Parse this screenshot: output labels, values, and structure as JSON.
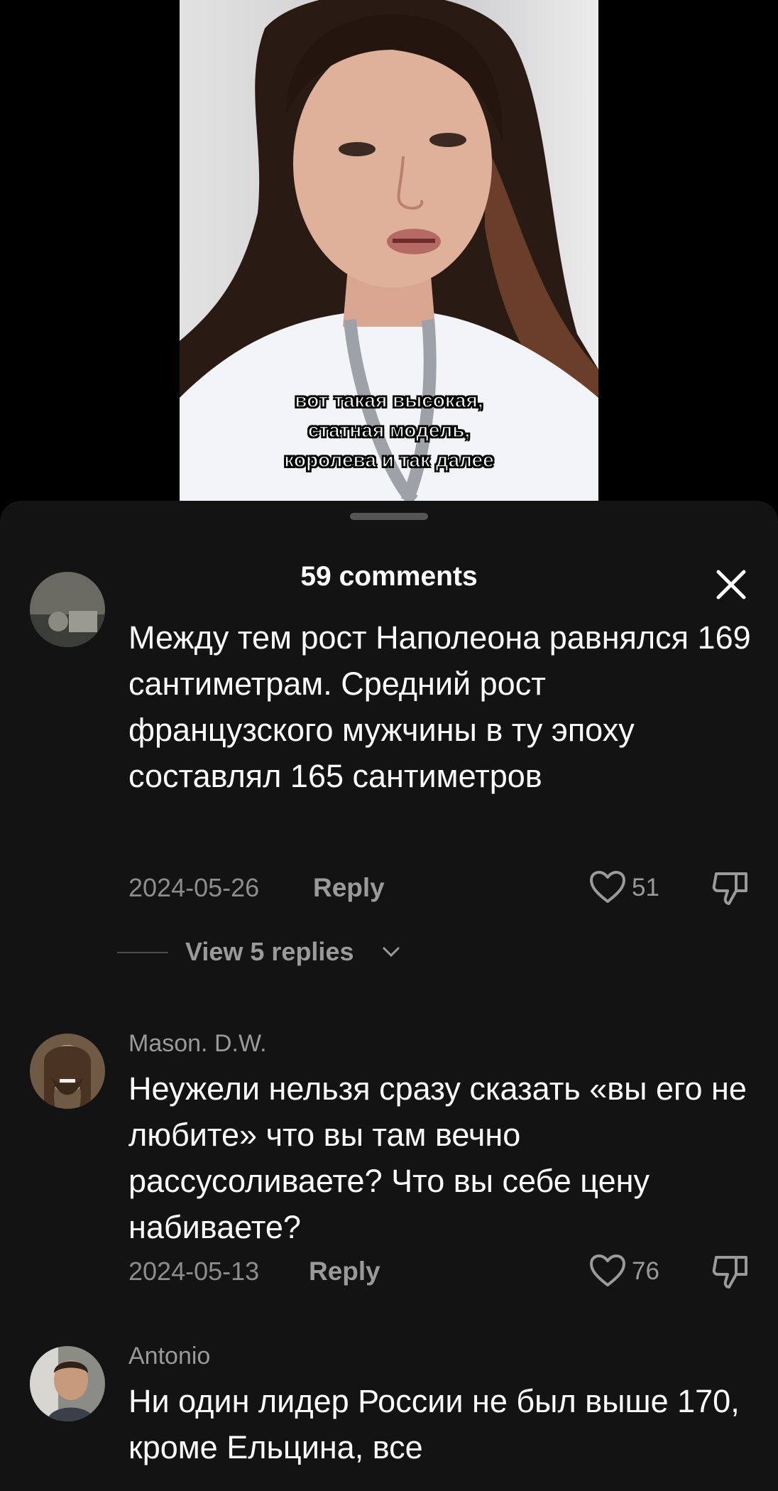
{
  "video": {
    "subtitle_lines": [
      "вот такая высокая,",
      "статная модель,",
      "королева и так далее"
    ]
  },
  "sheet": {
    "title": "59 comments",
    "close_icon": "close-icon"
  },
  "comments": [
    {
      "username": "",
      "text": "Между тем рост Наполеона равнялся 169 сантиметрам. Средний рост французского мужчины в ту эпоху составлял 165 сантиметров",
      "date": "2024-05-26",
      "reply_label": "Reply",
      "likes": "51",
      "view_replies_label": "View 5 replies"
    },
    {
      "username": "Mason. D.W.",
      "text": "Неужели нельзя сразу сказать «вы его не любите» что вы там вечно рассусоливаете? Что вы себе цену набиваете?",
      "date": "2024-05-13",
      "reply_label": "Reply",
      "likes": "76"
    },
    {
      "username": "Antonio",
      "text": "Ни один лидер России не был выше 170, кроме Ельцина, все"
    }
  ],
  "colors": {
    "sheet_bg": "#131313",
    "muted_text": "#9a9a9a",
    "primary_text": "#ffffff"
  }
}
